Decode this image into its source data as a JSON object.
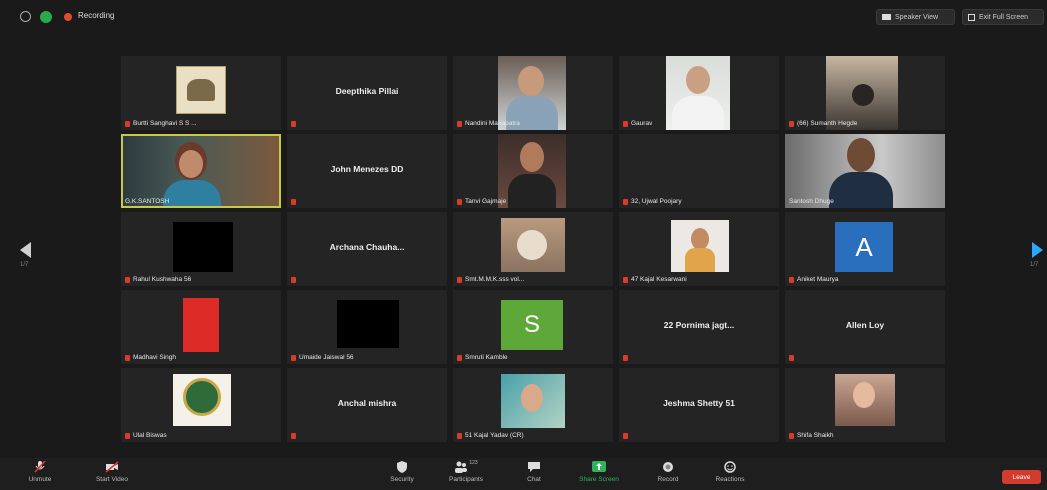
{
  "topbar": {
    "recording_label": "Recording",
    "speaker_view": "Speaker View",
    "exit_full_screen": "Exit Full Screen"
  },
  "colors": {
    "accent_blue": "#2aa8ff",
    "leave_red": "#d23b2e",
    "mic_red": "#d93a2b",
    "active_border": "#c8c84a"
  },
  "nav": {
    "prev_page": "1/7",
    "next_page": "1/7"
  },
  "tiles": [
    {
      "name": "Burtti Sanghavi S S ..."
    },
    {
      "name": "",
      "center": "Deepthika Pillai"
    },
    {
      "name": "Nandini Mahapatra"
    },
    {
      "name": "Gaurav"
    },
    {
      "name": "(66) Sumanth Hegde"
    },
    {
      "name": "G.K.SANTOSH"
    },
    {
      "name": "",
      "center": "John Menezes DD"
    },
    {
      "name": "Tanvi Gajmaje"
    },
    {
      "name": "32, Ujwal Poojary"
    },
    {
      "name": "Santosh Dhuge"
    },
    {
      "name": "Rahul Kushwaha 56"
    },
    {
      "name": "",
      "center": "Archana Chauha..."
    },
    {
      "name": "Smt.M.M.K.sss vol..."
    },
    {
      "name": "47 Kajal Kesarwani"
    },
    {
      "name": "Aniket Maurya",
      "avatar": "A"
    },
    {
      "name": "Madhavi Singh"
    },
    {
      "name": "Umaide Jaiswal 56"
    },
    {
      "name": "Smruti Kamble",
      "avatar": "S"
    },
    {
      "name": "",
      "center": "22 Pornima jagt..."
    },
    {
      "name": "",
      "center": "Allen Loy"
    },
    {
      "name": "Ulal Biswas"
    },
    {
      "name": "",
      "center": "Anchal mishra"
    },
    {
      "name": "51 Kajal Yadav (CR)"
    },
    {
      "name": "",
      "center": "Jeshma Shetty 51"
    },
    {
      "name": "Shifa Shaikh"
    }
  ],
  "toolbar": {
    "unmute": "Unmute",
    "start_video": "Start Video",
    "security": "Security",
    "participants": "Participants",
    "participants_count": "123",
    "chat": "Chat",
    "share_screen": "Share Screen",
    "record": "Record",
    "reactions": "Reactions",
    "leave": "Leave"
  }
}
